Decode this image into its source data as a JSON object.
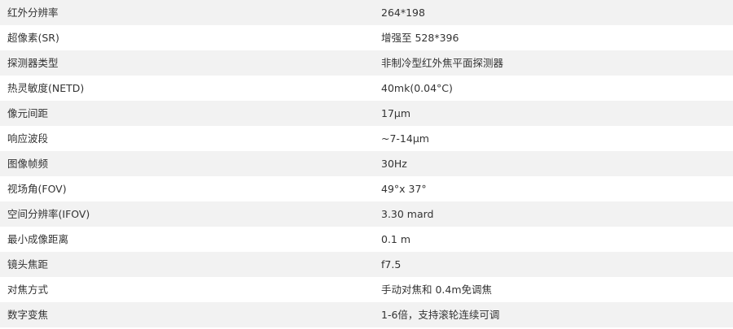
{
  "specs": [
    {
      "label": "红外分辨率",
      "value": "264*198"
    },
    {
      "label": "超像素(SR)",
      "value": "增强至 528*396"
    },
    {
      "label": "探测器类型",
      "value": "非制冷型红外焦平面探测器"
    },
    {
      "label": "热灵敏度(NETD)",
      "value": "40mk(0.04°C)"
    },
    {
      "label": "像元间距",
      "value": "17μm"
    },
    {
      "label": "响应波段",
      "value": "~7-14μm"
    },
    {
      "label": "图像帧频",
      "value": "30Hz"
    },
    {
      "label": "视场角(FOV)",
      "value": "49°x 37°"
    },
    {
      "label": "空间分辨率(IFOV)",
      "value": "3.30 mard"
    },
    {
      "label": "最小成像距离",
      "value": "0.1 m"
    },
    {
      "label": "镜头焦距",
      "value": "f7.5"
    },
    {
      "label": "对焦方式",
      "value": "手动对焦和 0.4m免调焦"
    },
    {
      "label": "数字变焦",
      "value": "1-6倍，支持滚轮连续可调"
    }
  ]
}
